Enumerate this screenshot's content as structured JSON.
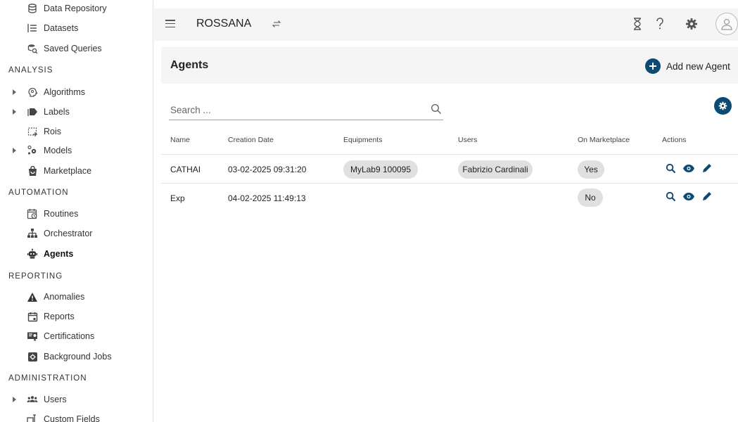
{
  "colors": {
    "accent": "#0d4a73",
    "chip": "#e0e0e0",
    "header_bg": "#f5f5f5"
  },
  "topbar": {
    "app_name": "ROSSANA"
  },
  "sidebar": {
    "items_top": [
      {
        "label": "Data Repository",
        "icon": "database-icon"
      },
      {
        "label": "Datasets",
        "icon": "list-icon"
      },
      {
        "label": "Saved Queries",
        "icon": "saved-query-icon"
      }
    ],
    "sections": [
      {
        "title": "ANALYSIS",
        "items": [
          {
            "label": "Algorithms",
            "icon": "algorithm-icon",
            "expandable": true
          },
          {
            "label": "Labels",
            "icon": "label-icon",
            "expandable": true
          },
          {
            "label": "Rois",
            "icon": "roi-icon",
            "expandable": false
          },
          {
            "label": "Models",
            "icon": "models-icon",
            "expandable": true
          },
          {
            "label": "Marketplace",
            "icon": "marketplace-icon",
            "expandable": false
          }
        ]
      },
      {
        "title": "AUTOMATION",
        "items": [
          {
            "label": "Routines",
            "icon": "routine-icon",
            "expandable": false
          },
          {
            "label": "Orchestrator",
            "icon": "orchestrator-icon",
            "expandable": false
          },
          {
            "label": "Agents",
            "icon": "agent-icon",
            "expandable": false,
            "active": true
          }
        ]
      },
      {
        "title": "REPORTING",
        "items": [
          {
            "label": "Anomalies",
            "icon": "warning-icon",
            "expandable": false
          },
          {
            "label": "Reports",
            "icon": "report-icon",
            "expandable": false
          },
          {
            "label": "Certifications",
            "icon": "certification-icon",
            "expandable": false
          },
          {
            "label": "Background Jobs",
            "icon": "background-jobs-icon",
            "expandable": false
          }
        ]
      },
      {
        "title": "ADMINISTRATION",
        "items": [
          {
            "label": "Users",
            "icon": "users-icon",
            "expandable": true
          },
          {
            "label": "Custom Fields",
            "icon": "custom-fields-icon",
            "expandable": false
          }
        ]
      }
    ]
  },
  "page": {
    "title": "Agents",
    "add_label": "Add new Agent",
    "search_placeholder": "Search ..."
  },
  "table": {
    "columns": [
      "Name",
      "Creation Date",
      "Equipments",
      "Users",
      "On Marketplace",
      "Actions"
    ],
    "rows": [
      {
        "name": "CATHAI",
        "date": "03-02-2025 09:31:20",
        "equipment": "MyLab9 100095",
        "user": "Fabrizio Cardinali",
        "marketplace": "Yes"
      },
      {
        "name": "Exp",
        "date": "04-02-2025 11:49:13",
        "equipment": "",
        "user": "",
        "marketplace": "No"
      }
    ],
    "row_actions": [
      "search-icon",
      "view-icon",
      "edit-icon"
    ]
  }
}
